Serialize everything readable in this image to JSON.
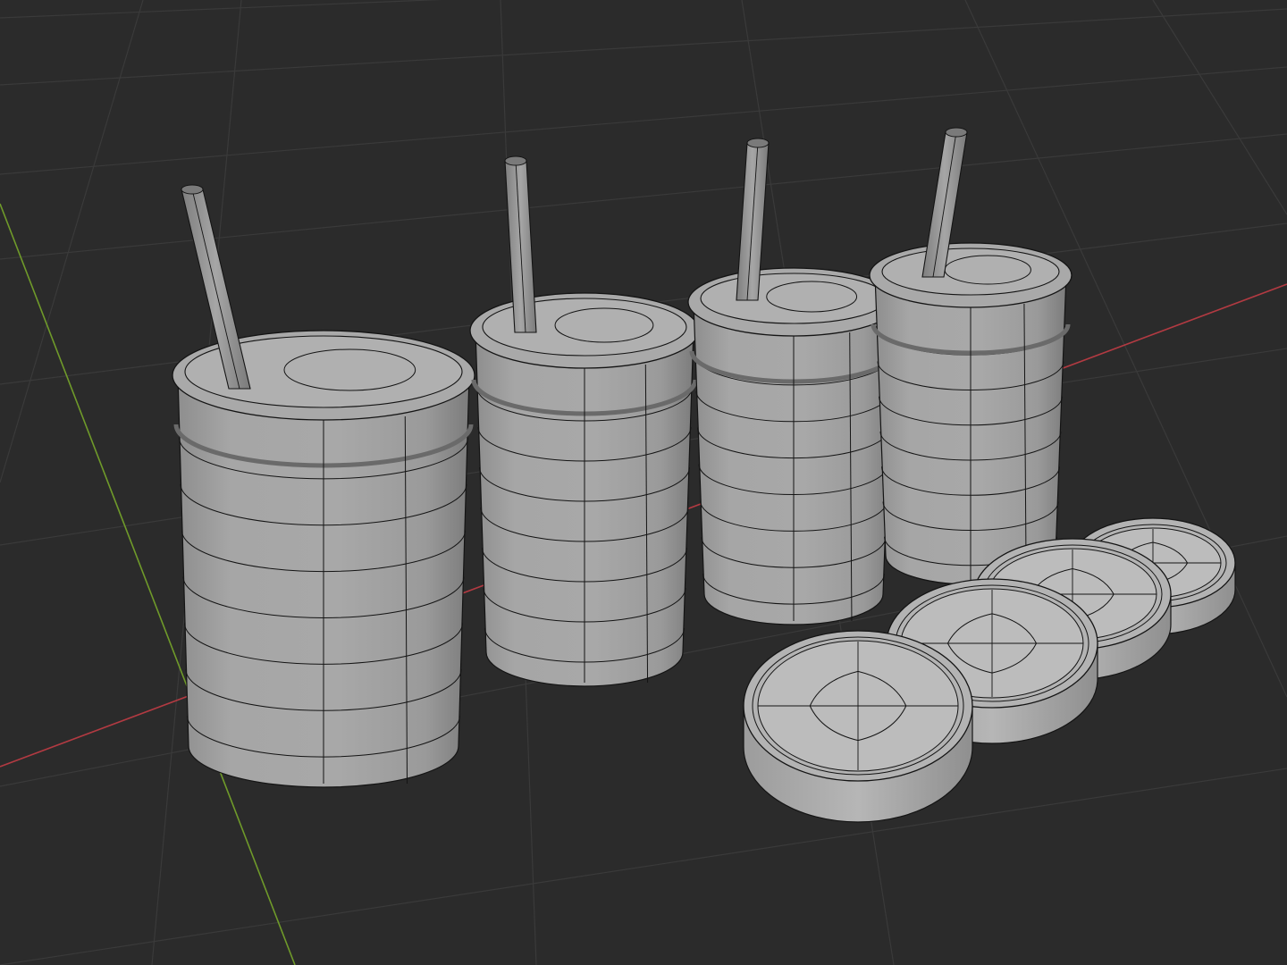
{
  "viewport": {
    "kind": "3d-viewport",
    "shading": "solid-wireframe",
    "background_color": "#2b2b2b",
    "grid_color": "#3a3a3a",
    "x_axis_color": "#b23a42",
    "y_axis_color": "#6f9a2a",
    "mesh_color": "#b4b4b4",
    "edge_color": "#141414"
  },
  "objects": [
    {
      "name": "cup-with-straw",
      "count": 4
    },
    {
      "name": "cup-lid",
      "count": 4
    }
  ]
}
